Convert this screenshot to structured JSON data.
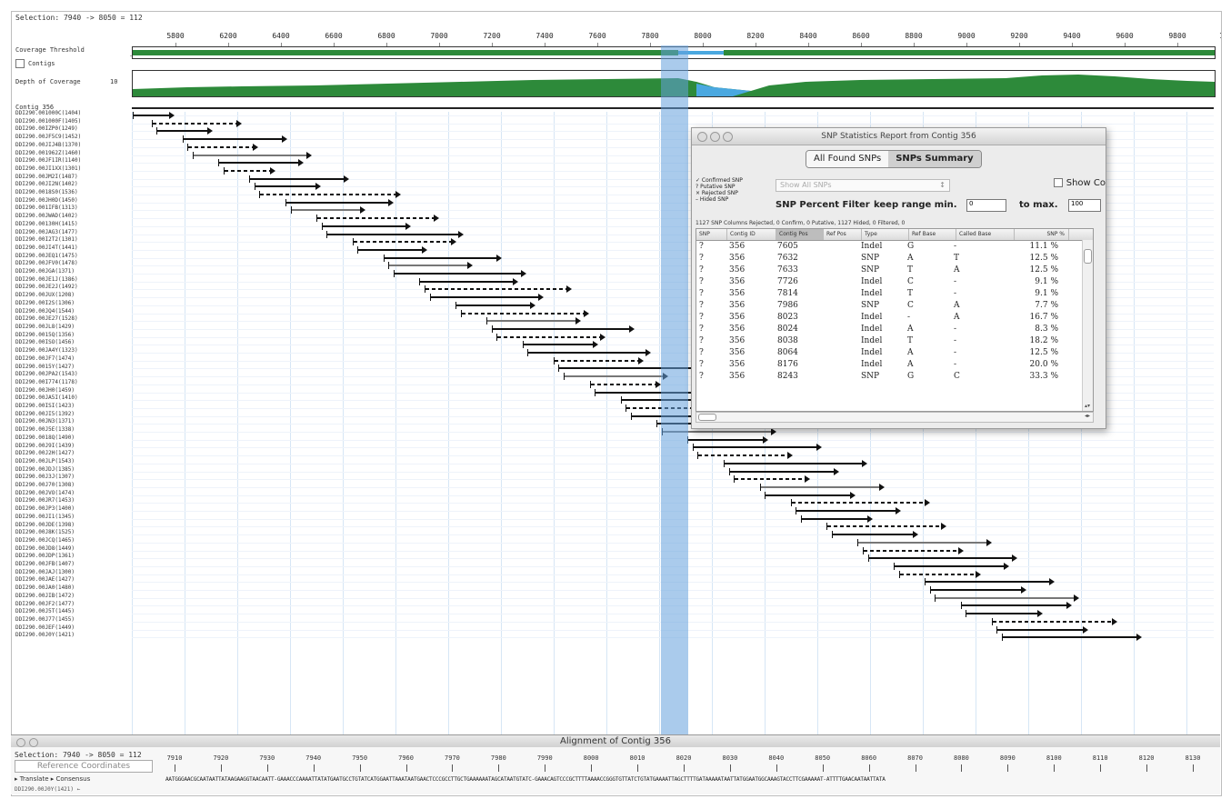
{
  "top": {
    "selection": "Selection: 7940 -> 8050 = 112",
    "ruler_ticks": [
      "5800",
      "6200",
      "6400",
      "6600",
      "6800",
      "7000",
      "7200",
      "7400",
      "7600",
      "7800",
      "8000",
      "8200",
      "8400",
      "8600",
      "8800",
      "9000",
      "9200",
      "9400",
      "9600",
      "9800",
      "10000"
    ],
    "coverage_threshold_label": "Coverage Threshold",
    "contigs_label": "Contigs",
    "depth_label": "Depth of Coverage",
    "depth_value": "10",
    "contig_label": "Contig 356"
  },
  "reads": {
    "names": [
      "DDI290.001000C(1404)",
      "DDI290.001000F(1405)",
      "DDI290.00IZP0(1249)",
      "DDI290.00JF5C9(1452)",
      "DDI290.00JIJ4B(1370)",
      "DDI290.001962Z(1460)",
      "DDI290.00JF1IR(1140)",
      "DDI290.00JI1XX(1301)",
      "DDI290.00JM2I(1487)",
      "DDI290.00JI2N(1402)",
      "DDI290.0018S0(1536)",
      "DDI290.00JH0D(1450)",
      "DDI290.001IFB(1313)",
      "DDI290.00JWAD(1402)",
      "DDI290.00130H(1415)",
      "DDI290.00JAG3(1477)",
      "DDI290.00I2T2(1301)",
      "DDI290.00JI4T(1441)",
      "DDI290.00JEQ1(1475)",
      "DDI290.00JFV0(1478)",
      "DDI290.00JGA(1371)",
      "DDI290.00JE1J(1386)",
      "DDI290.00JE2J(1492)",
      "DDI290.00JUX(1208)",
      "DDI290.00I2S(1306)",
      "DDI290.00JQ4(1544)",
      "DDI290.00JE27(1528)",
      "DDI290.00JL8(1429)",
      "DDI290.0015Q(1356)",
      "DDI290.00ISO(1456)",
      "DDI290.00JA4Y(1323)",
      "DDI290.00JF7(1474)",
      "DDI290.0015Y(1427)",
      "DDI290.00JPA2(1543)",
      "DDI290.00I774(1178)",
      "DDI290.00JH0(1459)",
      "DDI290.00JA5I(1410)",
      "DDI290.00ISI(1423)",
      "DDI290.00JI5(1392)",
      "DDI290.00JN3(1371)",
      "DDI290.00J5E(1338)",
      "DDI290.0018Q(1490)",
      "DDI290.00J9I(1439)",
      "DDI290.00J2H(1427)",
      "DDI290.00JLP(1543)",
      "DDI290.00JDJ(1385)",
      "DDI290.00J3J(1307)",
      "DDI290.00J70(1308)",
      "DDI290.00JVO(1474)",
      "DDI290.00JR7(1453)",
      "DDI290.00JP3(1400)",
      "DDI290.00JI1(1345)",
      "DDI290.00JDE(1398)",
      "DDI290.00J8K(1525)",
      "DDI290.00JCQ(1465)",
      "DDI290.00JD8(1449)",
      "DDI290.00JDP(1361)",
      "DDI290.00JFB(1407)",
      "DDI290.00JAJ(1300)",
      "DDI290.00JAE(1427)",
      "DDI290.00JA0(1480)",
      "DDI290.00JIB(1472)",
      "DDI290.00JF2(1477)",
      "DDI290.00J5T(1445)",
      "DDI290.00J77(1455)",
      "DDI290.00JEF(1449)",
      "DDI290.00J0Y(1421)"
    ]
  },
  "snp_window": {
    "title": "SNP Statistics Report from Contig 356",
    "tab_all": "All Found SNPs",
    "tab_summary": "SNPs Summary",
    "show_co": "Show Co",
    "legend": [
      "✓ Confirmed SNP",
      "? Putative SNP",
      "× Rejected SNP",
      "– Hided SNP"
    ],
    "dropdown": "Show All SNPs",
    "pct_filter": "SNP Percent Filter",
    "keep_range": "keep range  min.",
    "min_value": "0",
    "to_max": "to max.",
    "max_value": "100",
    "summary": "1127 SNP Columns Rejected, 0 Confirm, 0 Putative, 1127 Hided, 0 Filtered, 0",
    "columns": [
      "SNP",
      "Contig ID",
      "Contig Pos",
      "Ref Pos",
      "Type",
      "Ref Base",
      "Called Base",
      "SNP %"
    ],
    "rows": [
      [
        "?",
        "356",
        "7605",
        "",
        "Indel",
        "G",
        "-",
        "11.1 %"
      ],
      [
        "?",
        "356",
        "7632",
        "",
        "SNP",
        "A",
        "T",
        "12.5 %"
      ],
      [
        "?",
        "356",
        "7633",
        "",
        "SNP",
        "T",
        "A",
        "12.5 %"
      ],
      [
        "?",
        "356",
        "7726",
        "",
        "Indel",
        "C",
        "-",
        "9.1 %"
      ],
      [
        "?",
        "356",
        "7814",
        "",
        "Indel",
        "T",
        "-",
        "9.1 %"
      ],
      [
        "?",
        "356",
        "7986",
        "",
        "SNP",
        "C",
        "A",
        "7.7 %"
      ],
      [
        "?",
        "356",
        "8023",
        "",
        "Indel",
        "-",
        "A",
        "16.7 %"
      ],
      [
        "?",
        "356",
        "8024",
        "",
        "Indel",
        "A",
        "-",
        "8.3 %"
      ],
      [
        "?",
        "356",
        "8038",
        "",
        "Indel",
        "T",
        "-",
        "18.2 %"
      ],
      [
        "?",
        "356",
        "8064",
        "",
        "Indel",
        "A",
        "-",
        "12.5 %"
      ],
      [
        "?",
        "356",
        "8176",
        "",
        "Indel",
        "A",
        "-",
        "20.0 %"
      ],
      [
        "?",
        "356",
        "8243",
        "",
        "SNP",
        "G",
        "C",
        "33.3 %"
      ]
    ]
  },
  "alignment": {
    "title": "Alignment of Contig 356",
    "selection": "Selection: 7940 -> 8050 = 112",
    "ref_coords": "Reference Coordinates",
    "ticks": [
      "7910",
      "7920",
      "7930",
      "7940",
      "7950",
      "7960",
      "7970",
      "7980",
      "7990",
      "8000",
      "8010",
      "8020",
      "8030",
      "8040",
      "8050",
      "8060",
      "8070",
      "8080",
      "8090",
      "8100",
      "8110",
      "8120",
      "8130"
    ],
    "translate": "▸ Translate  ▸ Consensus",
    "sequence": "AATGGGAACGCAATAATTATAAGAAGGTAACAATT-GAAACCCAAAATTATATGAATGCCTGTATCATGGAATTAAATAATGAACTCCCGCCTTGCTGAAAAAATAGCATAATGTATC-GAAACAGTCCCGCTTTTAAAACCGGGTGTTATCTGTATGAAAATTAGCTTTTGATAAAAATAATTATGGAATGGCAAAGTACCTTCGAAAAAT-ATTTTGAACAATAATTATA",
    "status": "DDI290.00J0Y(1421)  ←"
  }
}
